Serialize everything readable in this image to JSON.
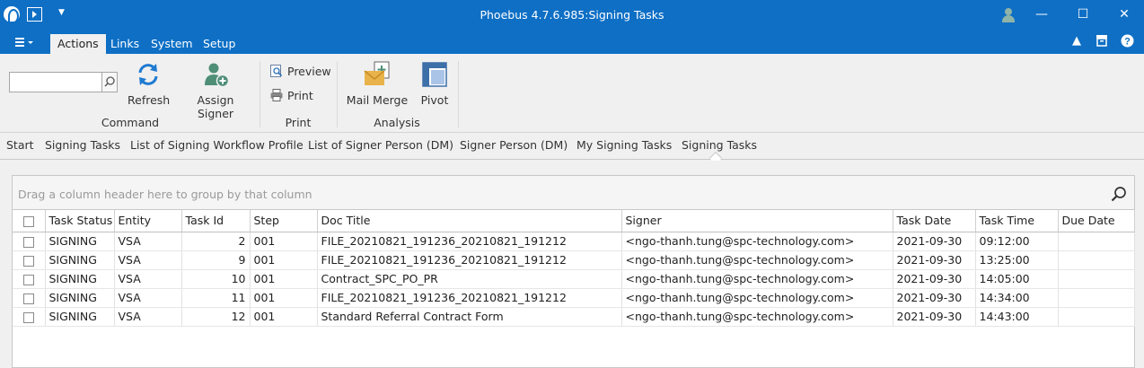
{
  "window": {
    "title": "Phoebus 4.7.6.985:Signing Tasks",
    "controls": {
      "minimize": "—",
      "maximize": "☐",
      "close": "✕"
    }
  },
  "menu": {
    "tabs": [
      {
        "label": "Actions",
        "active": true
      },
      {
        "label": "Links"
      },
      {
        "label": "System"
      },
      {
        "label": "Setup"
      }
    ]
  },
  "ribbon": {
    "search": {
      "value": "",
      "placeholder": ""
    },
    "groups": {
      "command": {
        "label": "Command",
        "refresh": "Refresh",
        "assign_signer": "Assign Signer"
      },
      "print": {
        "label": "Print",
        "preview": "Preview",
        "print": "Print"
      },
      "analysis": {
        "label": "Analysis",
        "mail_merge": "Mail Merge",
        "pivot": "Pivot"
      }
    }
  },
  "nav": {
    "items": [
      "Start",
      "Signing Tasks",
      "List of Signing Workflow Profile",
      "List of Signer Person (DM)",
      "Signer Person (DM)",
      "My Signing Tasks",
      "Signing Tasks"
    ]
  },
  "grid": {
    "group_hint": "Drag a column header here to group by that column",
    "columns": [
      "Task Status",
      "Entity",
      "Task Id",
      "Step",
      "Doc Title",
      "Signer",
      "Task Date",
      "Task Time",
      "Due Date"
    ],
    "rows": [
      {
        "status": "SIGNING",
        "entity": "VSA",
        "task_id": "2",
        "step": "001",
        "doc_title": "FILE_20210821_191236_20210821_191212",
        "signer": "<ngo-thanh.tung@spc-technology.com>",
        "task_date": "2021-09-30",
        "task_time": "09:12:00",
        "due_date": ""
      },
      {
        "status": "SIGNING",
        "entity": "VSA",
        "task_id": "9",
        "step": "001",
        "doc_title": "FILE_20210821_191236_20210821_191212",
        "signer": "<ngo-thanh.tung@spc-technology.com>",
        "task_date": "2021-09-30",
        "task_time": "13:25:00",
        "due_date": ""
      },
      {
        "status": "SIGNING",
        "entity": "VSA",
        "task_id": "10",
        "step": "001",
        "doc_title": "Contract_SPC_PO_PR",
        "signer": "<ngo-thanh.tung@spc-technology.com>",
        "task_date": "2021-09-30",
        "task_time": "14:05:00",
        "due_date": ""
      },
      {
        "status": "SIGNING",
        "entity": "VSA",
        "task_id": "11",
        "step": "001",
        "doc_title": "FILE_20210821_191236_20210821_191212",
        "signer": "<ngo-thanh.tung@spc-technology.com>",
        "task_date": "2021-09-30",
        "task_time": "14:34:00",
        "due_date": ""
      },
      {
        "status": "SIGNING",
        "entity": "VSA",
        "task_id": "12",
        "step": "001",
        "doc_title": "Standard Referral Contract Form",
        "signer": "<ngo-thanh.tung@spc-technology.com>",
        "task_date": "2021-09-30",
        "task_time": "14:43:00",
        "due_date": ""
      }
    ]
  },
  "colors": {
    "title_bar": "#0e6fc5",
    "refresh_icon": "#1f7ad1",
    "user_icon": "#4f8f78",
    "mail_icon": "#e8b34a"
  }
}
